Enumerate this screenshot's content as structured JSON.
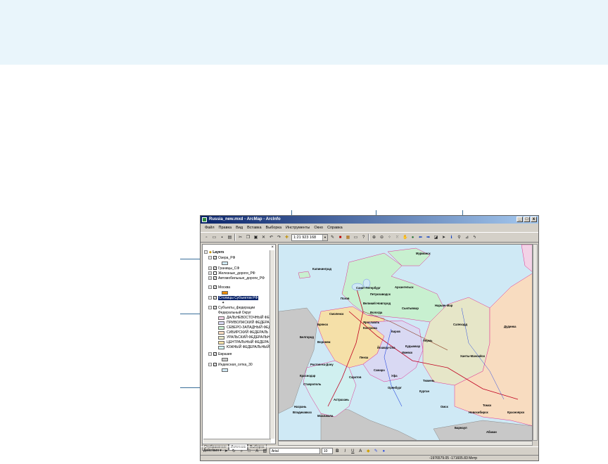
{
  "window": {
    "title": "Russia_new.mxd - ArcMap - ArcInfo",
    "controls": [
      "_",
      "□",
      "x"
    ]
  },
  "menu": [
    "Файл",
    "Правка",
    "Вид",
    "Вставка",
    "Выборка",
    "Инструменты",
    "Окно",
    "Справка"
  ],
  "toolbar": {
    "scale": "1:21 923 168"
  },
  "toc": {
    "root": "Layers",
    "layers": [
      {
        "name": "Озера_РФ",
        "checked": true
      },
      {
        "name": "Границы_СФ",
        "checked": true
      },
      {
        "name": "Железные_дороги_РФ",
        "checked": false
      },
      {
        "name": "Автомобильные_дороги_РФ",
        "checked": true
      },
      {
        "name": "Москва",
        "checked": true
      },
      {
        "name": "Столицы Субъектов РФ",
        "checked": true
      },
      {
        "name": "Субъекты_федерации",
        "checked": true
      },
      {
        "name": "Евразия",
        "checked": true
      },
      {
        "name": "Индексная_сетка_30",
        "checked": true
      }
    ],
    "field_label": "Федеральный Округ",
    "classes": [
      {
        "name": "ДАЛЬНЕВОСТОЧНЫЙ ФЕ",
        "color": "#f3d2e6"
      },
      {
        "name": "ПРИВОЛЖСКИЙ ФЕДЕРА",
        "color": "#d9d9f3"
      },
      {
        "name": "СЕВЕРО-ЗАПАДНЫЙ ФЕД",
        "color": "#c8f0d0"
      },
      {
        "name": "СИБИРСКИЙ ФЕДЕРАЛЬ",
        "color": "#f8dcc0"
      },
      {
        "name": "УРАЛЬСКИЙ ФЕДЕРАЛЬН",
        "color": "#e6e6c8"
      },
      {
        "name": "ЦЕНТРАЛЬНЫЙ ФЕДЕРА",
        "color": "#f5e0a8"
      },
      {
        "name": "ЮЖНЫЙ ФЕДЕРАЛЬНЫЙ",
        "color": "#d0f0f0"
      }
    ],
    "tabs": [
      "Отображение",
      "Источник",
      "Выборка"
    ]
  },
  "map": {
    "cities": [
      "Мурманск",
      "Калининград",
      "Санкт-Петербург",
      "Архангельск",
      "Нарьян-Мар",
      "Псков",
      "Петрозаводск",
      "Великий Новгород",
      "Смоленск",
      "Вологда",
      "Сыктывкар",
      "Брянск",
      "Ярославль",
      "Кострома",
      "Белгород",
      "Воронеж",
      "Киров",
      "Пермь",
      "Салехард",
      "Дудинка",
      "Ижевск",
      "Йошкар-Ола",
      "Кудымкар",
      "Пенза",
      "Самара",
      "Уфа",
      "Ростов-на-Дону",
      "Саратов",
      "Краснодар",
      "Ставрополь",
      "Оренбург",
      "Курган",
      "Астрахань",
      "Ханты-Мансийск",
      "Тюмень",
      "Омск",
      "Томск",
      "Красноярск",
      "Новосибирск",
      "Барнаул",
      "Абакан",
      "Махачкала",
      "Назрань",
      "Владикавказ"
    ]
  },
  "drawing": {
    "label": "Действия ▾",
    "font": "Arial",
    "size": "10",
    "styles": [
      "B",
      "I",
      "U"
    ]
  },
  "status": {
    "coords": "-1976579.05 -171605.83 Метр"
  },
  "colors": {
    "sea": "#cfe9f5",
    "land_outside": "#c8c8c8",
    "highlight": "#0a246a"
  }
}
